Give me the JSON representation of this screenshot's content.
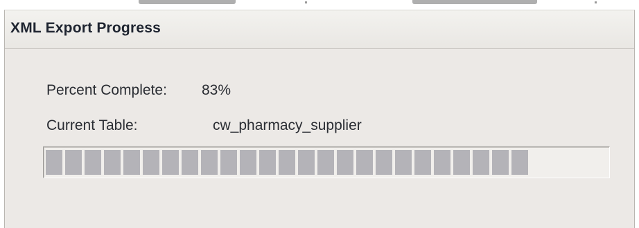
{
  "dialog": {
    "title": "XML Export Progress",
    "percent_label": "Percent Complete:",
    "percent_value": "83%",
    "table_label": "Current Table:",
    "table_value": "cw_pharmacy_supplier"
  },
  "progress": {
    "fraction": 0.86,
    "block_count": 25
  },
  "colors": {
    "dialog_bg": "#ece9e6",
    "block": "#b4b3b8",
    "text": "#2a2d33"
  }
}
